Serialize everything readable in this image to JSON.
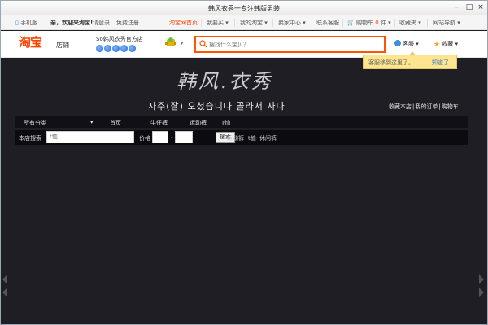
{
  "window": {
    "title": "韩风衣秀一专注韩版男装"
  },
  "topbar": {
    "mobile": "手机版",
    "welcome": "亲，欢迎来淘宝!",
    "login": "请登录",
    "register": "免费注册",
    "home": "淘宝网首页",
    "buy": "我要买",
    "mytaobao": "我的淘宝",
    "seller": "卖家中心",
    "service": "联系客服",
    "cart_label": "购物车",
    "cart_count": "0",
    "cart_unit": "件",
    "favorites": "收藏夹",
    "sitenav": "网站导航"
  },
  "header": {
    "logo": "淘宝",
    "logo_sub": "店铺",
    "shop_name": "So韩风衣秀官方店",
    "search_placeholder": "搜找什么宝贝？",
    "kefu": "客服",
    "shoucang": "收藏"
  },
  "tooltip": {
    "text": "客服移到这里了。",
    "link": "知道了"
  },
  "banner": {
    "title": "韩风.衣秀",
    "subtitle": "자주(잘) 오셨습니다 골라서 사다",
    "links": [
      "收藏本店",
      "我的订单",
      "购物车"
    ]
  },
  "nav": {
    "items": [
      "所有分类",
      "首页",
      "牛仔裤",
      "运动裤",
      "T恤"
    ]
  },
  "subbar": {
    "label": "本店搜索",
    "keyword": "t恤",
    "price_label": "价格",
    "price_sep": "-",
    "button": "搜索",
    "hot": [
      "运动裤",
      "t恤",
      "休闲裤"
    ]
  },
  "colors": {
    "accent": "#ff4400",
    "banner_bg": "#1e1e24",
    "tooltip_bg": "#ffe58f"
  }
}
